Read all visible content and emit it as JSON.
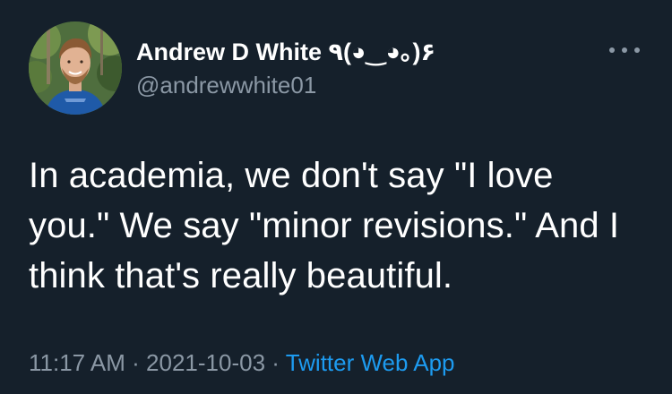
{
  "author": {
    "display_name": "Andrew D White ٩(◕‿◕｡)۶",
    "handle": "@andrewwhite01"
  },
  "tweet": {
    "text_lines": [
      "In academia, we don't say \"I love",
      "you.\" We say \"minor revisions.\" And I",
      "think that's really beautiful."
    ]
  },
  "meta": {
    "time": "11:17 AM",
    "separator_1": " · ",
    "date": "2021-10-03",
    "separator_2": " · ",
    "source": "Twitter Web App"
  },
  "icons": {
    "more": "more-horizontal-icon",
    "avatar": "profile-photo"
  },
  "colors": {
    "background": "#15202b",
    "primary_text": "#ffffff",
    "secondary_text": "#8b98a5",
    "accent": "#1d9bf0"
  }
}
